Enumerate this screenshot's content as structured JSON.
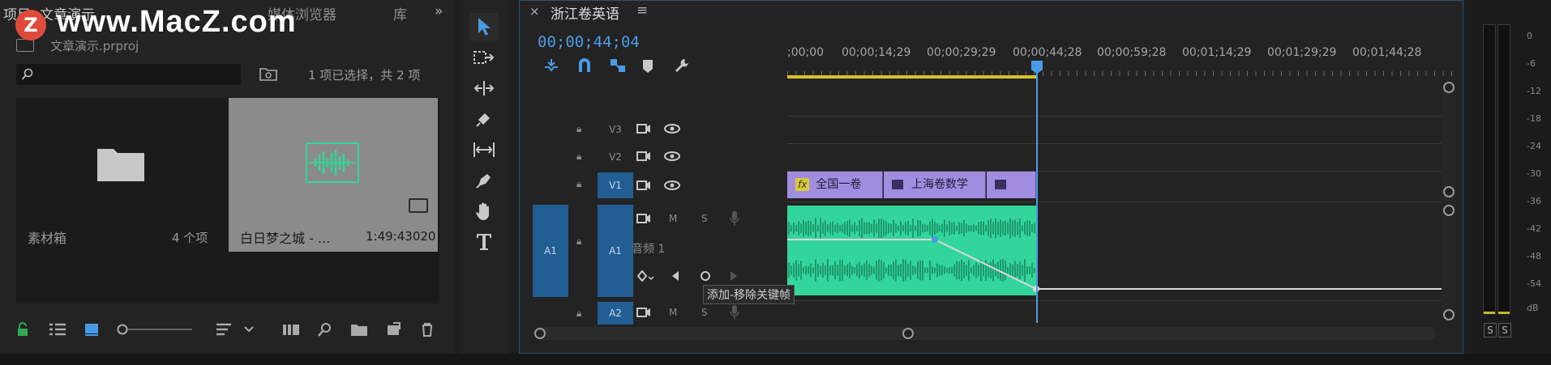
{
  "project_panel": {
    "tabs": [
      "项目: 文章演示",
      "媒体浏览器",
      "库"
    ],
    "file_name": "文章演示.prproj",
    "search_placeholder": "",
    "selection_info": "1 项已选择，共 2 项",
    "bin": {
      "name": "素材箱",
      "count": "4 个项"
    },
    "clip": {
      "name": "白日梦之城 - ...",
      "duration": "1:49:43020"
    }
  },
  "watermark": {
    "badge": "Z",
    "text": "www.MacZ.com"
  },
  "sequence": {
    "close": "×",
    "title": "浙江卷英语",
    "menu": "≡",
    "timecode": "00;00;44;04",
    "ruler_labels": [
      ";00;00",
      "00;00;14;29",
      "00;00;29;29",
      "00;00;44;28",
      "00;00;59;28",
      "00;01;14;29",
      "00;01;29;29",
      "00;01;44;28"
    ]
  },
  "tracks": {
    "v3": "V3",
    "v2": "V2",
    "v1": "V1",
    "a1_source": "A1",
    "a1": "A1",
    "a2": "A2",
    "mute": "M",
    "solo": "S",
    "audio_track_name": "音频 1"
  },
  "video_clips": [
    {
      "label": "全国一卷",
      "has_fx": true
    },
    {
      "label": "上海卷数学",
      "has_fx": false
    },
    {
      "label": "",
      "has_fx": false
    }
  ],
  "fx_label": "fx",
  "tooltip": "添加-移除关键帧",
  "meter": {
    "db_labels": [
      "0",
      "-6",
      "-12",
      "-18",
      "-24",
      "-30",
      "-36",
      "-42",
      "-48",
      "-54",
      "dB"
    ],
    "solo_buttons": [
      "S",
      "S"
    ]
  },
  "colors": {
    "accent": "#4a9be6",
    "audio_clip": "#32d69a",
    "video_clip": "#a18ddf",
    "work_area": "#d5c22c"
  }
}
